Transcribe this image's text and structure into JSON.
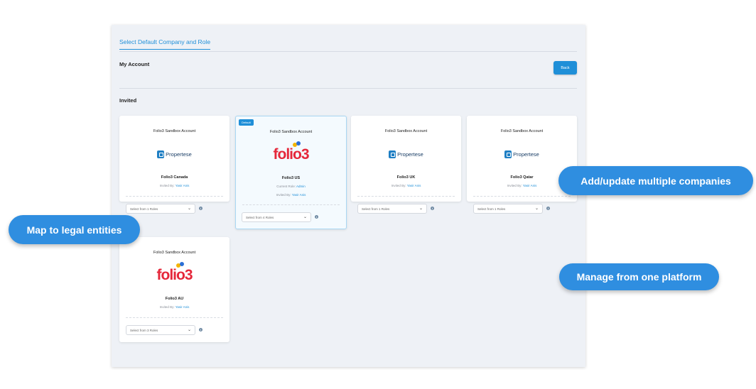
{
  "tab": {
    "label": "Select Default Company and Role"
  },
  "account": {
    "title": "My Account",
    "back_label": "Back"
  },
  "invited": {
    "title": "Invited"
  },
  "cards": [
    {
      "header": "Folio3 Sandbox Account",
      "logo": "propertese",
      "name": "Folio3 Canada",
      "invited_prefix": "Invited By:",
      "invited_by": "Yasir Anis",
      "select": "Select from 1 Roles",
      "default": false
    },
    {
      "header": "Folio3 Sandbox Account",
      "logo": "folio3",
      "name": "Folio3 US",
      "current_prefix": "Current Role:",
      "current_role": "Admin",
      "invited_prefix": "Invited By:",
      "invited_by": "Yasir Anis",
      "select": "Select from 4 Roles",
      "default": true,
      "badge": "Default"
    },
    {
      "header": "Folio3 Sandbox Account",
      "logo": "propertese",
      "name": "Folio3 UK",
      "invited_prefix": "Invited By:",
      "invited_by": "Yasir Anis",
      "select": "Select from 1 Roles",
      "default": false
    },
    {
      "header": "Folio3 Sandbox Account",
      "logo": "propertese",
      "name": "Folio3 Qatar",
      "invited_prefix": "Invited By:",
      "invited_by": "Yasir Anis",
      "select": "Select from 1 Roles",
      "default": false
    },
    {
      "header": "Folio3 Sandbox Account",
      "logo": "folio3",
      "name": "Folio3 AU",
      "invited_prefix": "Invited By:",
      "invited_by": "Yasir Anis",
      "select": "Select from 3 Roles",
      "default": false
    }
  ],
  "logos": {
    "propertese_text": "Propertese",
    "folio3_text": "folio3"
  },
  "callouts": {
    "companies": "Add/update multiple companies",
    "legal": "Map to legal entities",
    "platform": "Manage from one platform"
  },
  "colors": {
    "accent": "#1f8fd8",
    "callout": "#2f8ee0",
    "folio_red": "#e5273a"
  }
}
